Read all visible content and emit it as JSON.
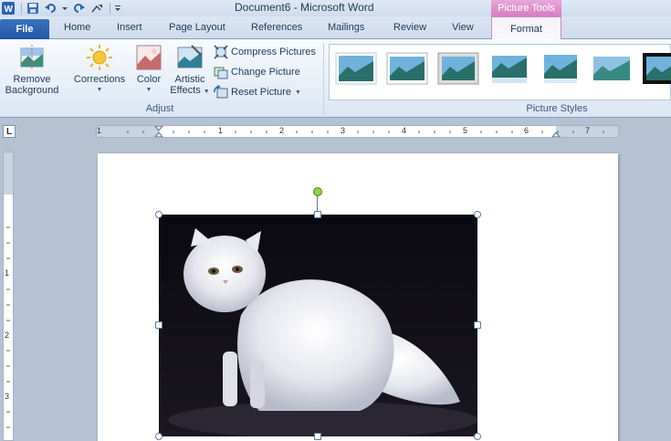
{
  "window": {
    "title": "Document6  -  Microsoft Word",
    "context_tab_group": "Picture Tools"
  },
  "qat": {
    "word_icon": "word-logo-icon",
    "save_icon": "save-icon",
    "undo_icon": "undo-icon",
    "redo_icon": "redo-icon",
    "repeat_icon": "repeat-icon",
    "customize_icon": "customize-qat-icon"
  },
  "tabs": {
    "file": "File",
    "items": [
      "Home",
      "Insert",
      "Page Layout",
      "References",
      "Mailings",
      "Review",
      "View"
    ],
    "active": "Format"
  },
  "ribbon": {
    "adjust": {
      "remove_background": [
        "Remove",
        "Background"
      ],
      "corrections": "Corrections",
      "color": "Color",
      "artistic_effects": [
        "Artistic",
        "Effects"
      ],
      "compress_pictures": "Compress Pictures",
      "change_picture": "Change Picture",
      "reset_picture": "Reset Picture",
      "group_label": "Adjust"
    },
    "picture_styles": {
      "group_label": "Picture Styles",
      "thumb_count": 7
    }
  },
  "ruler": {
    "h_numbers": [
      "1",
      "1",
      "2",
      "3",
      "4",
      "5",
      "6",
      "7"
    ],
    "v_numbers": [
      "1",
      "2",
      "3"
    ],
    "corner": "L"
  },
  "colors": {
    "file_tab": "#2a62b0",
    "context_tab": "#d67dc3",
    "rotation_handle": "#8fd14a"
  }
}
